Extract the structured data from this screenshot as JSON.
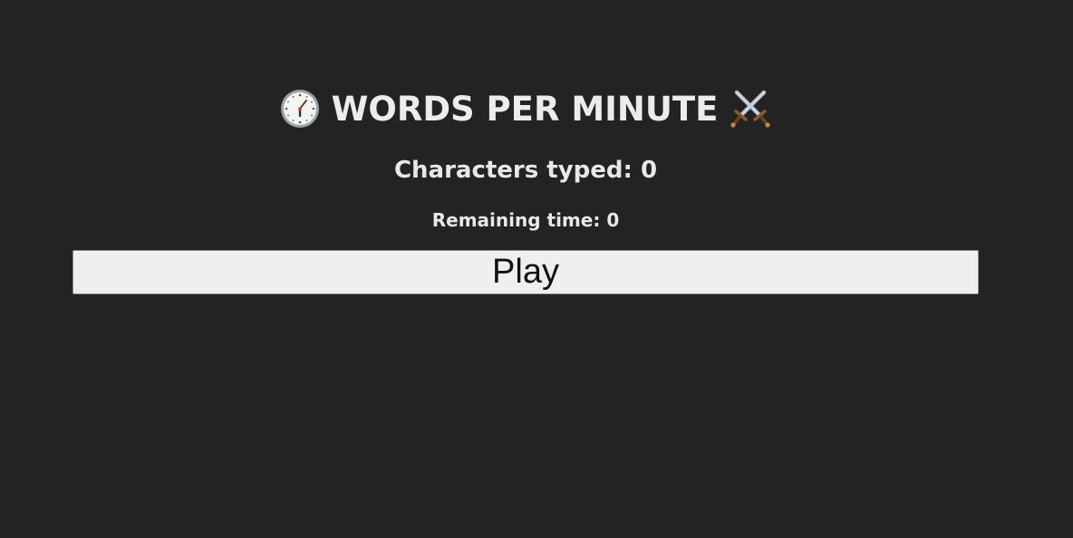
{
  "header": {
    "title": "WORDS PER MINUTE",
    "left_icon": "clock-icon",
    "right_icon": "crossed-swords-icon"
  },
  "stats": {
    "characters_label": "Characters typed:",
    "characters_value": "0",
    "time_label": "Remaining time:",
    "time_value": "0"
  },
  "controls": {
    "play_label": "Play"
  }
}
